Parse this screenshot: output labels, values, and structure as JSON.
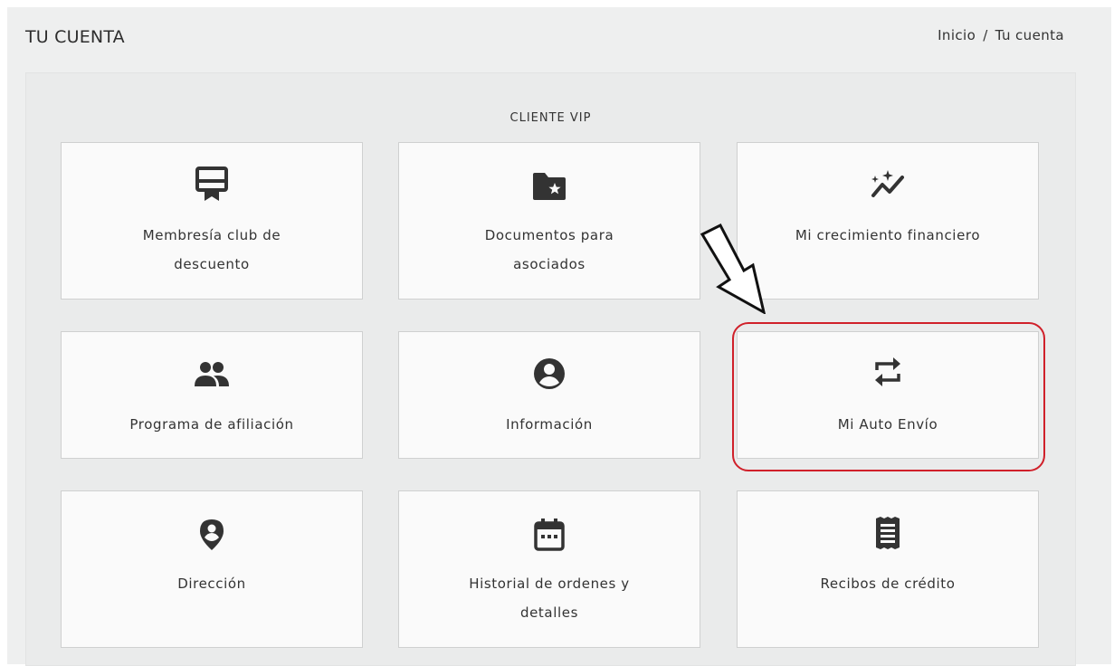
{
  "header": {
    "title": "TU CUENTA",
    "breadcrumb": {
      "home": "Inicio",
      "separator": "/",
      "current": "Tu cuenta"
    }
  },
  "section": {
    "title": "CLIENTE VIP"
  },
  "cards": [
    {
      "label_line1": "Membresía club de",
      "label_line2": "descuento",
      "icon": "certificate-icon"
    },
    {
      "label_line1": "Documentos para",
      "label_line2": "asociados",
      "icon": "folder-star-icon"
    },
    {
      "label_line1": "Mi crecimiento financiero",
      "label_line2": "",
      "icon": "trending-sparkle-icon"
    },
    {
      "label_line1": "Programa de afiliación",
      "label_line2": "",
      "icon": "people-icon"
    },
    {
      "label_line1": "Información",
      "label_line2": "",
      "icon": "account-circle-icon"
    },
    {
      "label_line1": "Mi Auto Envío",
      "label_line2": "",
      "icon": "repeat-icon"
    },
    {
      "label_line1": "Dirección",
      "label_line2": "",
      "icon": "location-pin-icon"
    },
    {
      "label_line1": "Historial de ordenes y",
      "label_line2": "detalles",
      "icon": "calendar-icon"
    },
    {
      "label_line1": "Recibos de crédito",
      "label_line2": "",
      "icon": "receipt-icon"
    }
  ],
  "annotation": {
    "highlight_color": "#d0202a"
  }
}
